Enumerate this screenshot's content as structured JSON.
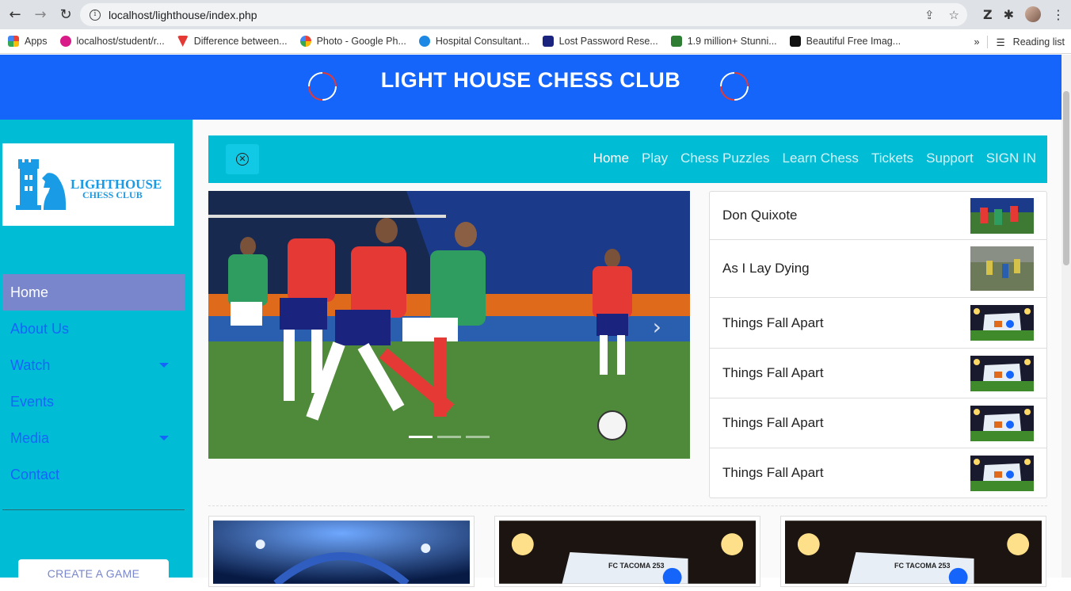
{
  "browser": {
    "url": "localhost/lighthouse/index.php",
    "bookmarks": [
      {
        "label": "Apps",
        "color": "#ea4335"
      },
      {
        "label": "localhost/student/r...",
        "color": "#d81b88"
      },
      {
        "label": "Difference between...",
        "color": "#e53935"
      },
      {
        "label": "Photo - Google Ph...",
        "color": "#fbbc05"
      },
      {
        "label": "Hospital Consultant...",
        "color": "#1e88e5"
      },
      {
        "label": "Lost Password Rese...",
        "color": "#1a237e"
      },
      {
        "label": "1.9 million+ Stunni...",
        "color": "#2e7d32"
      },
      {
        "label": "Beautiful Free Imag...",
        "color": "#111111"
      }
    ],
    "more_label": "»",
    "reading_list": "Reading list"
  },
  "header": {
    "title": "LIGHT HOUSE CHESS CLUB",
    "brand_color": "#1565fa"
  },
  "logo": {
    "line1": "LIGHTHOUSE",
    "line2": "CHESS CLUB"
  },
  "sidebar": {
    "items": [
      {
        "label": "Home",
        "active": true
      },
      {
        "label": "About Us"
      },
      {
        "label": "Watch",
        "dropdown": true
      },
      {
        "label": "Events"
      },
      {
        "label": "Media",
        "dropdown": true
      },
      {
        "label": "Contact"
      }
    ],
    "create_button": "CREATE A GAME"
  },
  "navbar": {
    "links": [
      "Home",
      "Play",
      "Chess Puzzles",
      "Learn Chess",
      "Tickets",
      "Support",
      "SIGN IN"
    ]
  },
  "carousel": {
    "slides": 3,
    "active_slide": 1
  },
  "side_list": [
    {
      "title": "Don Quixote"
    },
    {
      "title": "As I Lay Dying"
    },
    {
      "title": "Things Fall Apart"
    },
    {
      "title": "Things Fall Apart"
    },
    {
      "title": "Things Fall Apart"
    },
    {
      "title": "Things Fall Apart"
    }
  ],
  "cards": [
    {
      "caption": ""
    },
    {
      "caption": "FC TACOMA 253"
    },
    {
      "caption": "FC TACOMA 253"
    }
  ]
}
